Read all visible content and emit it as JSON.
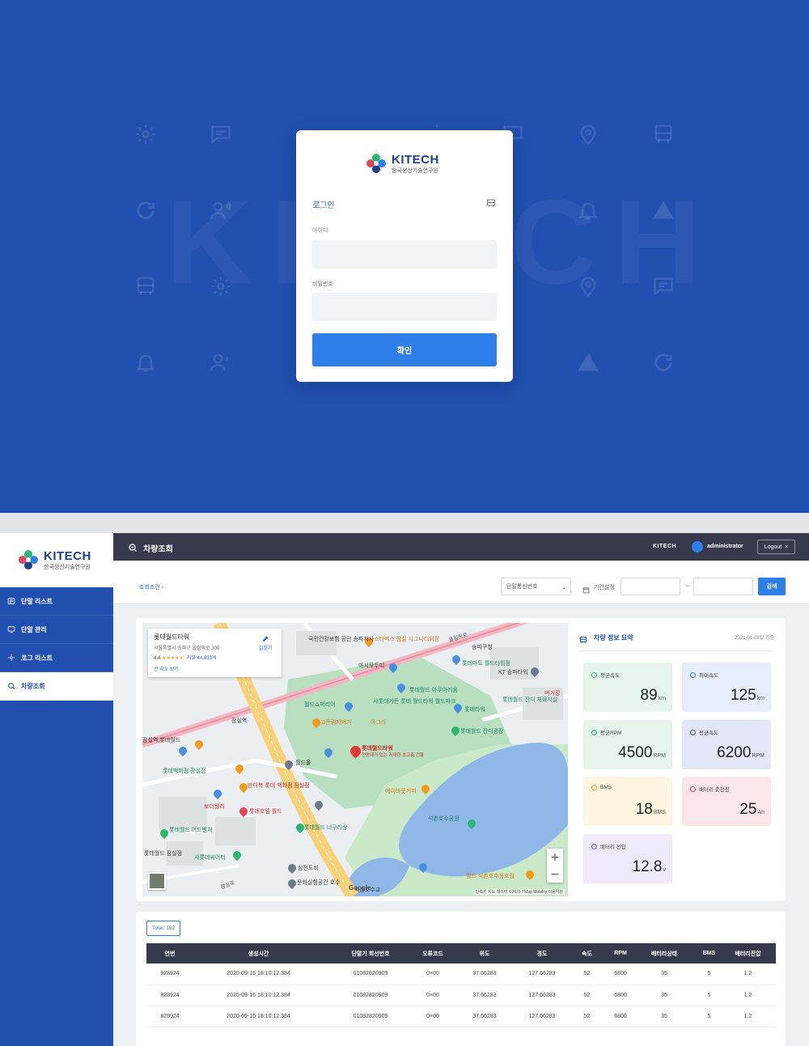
{
  "login": {
    "logo_brand": "KITECH",
    "logo_sub": "한국생산기술연구원",
    "title": "로그인",
    "id_label": "아이디",
    "id_value": "",
    "password_label": "비밀번호",
    "password_value": "",
    "submit_label": "확인",
    "background_word": "KITECH"
  },
  "sidebar": {
    "logo_brand": "KITECH",
    "logo_sub": "한국생산기술연구원",
    "items": [
      {
        "label": "단말 리스트",
        "icon": "list-icon",
        "active": false
      },
      {
        "label": "단말 관리",
        "icon": "device-icon",
        "active": false
      },
      {
        "label": "로그 리스트",
        "icon": "gear-icon",
        "active": false
      },
      {
        "label": "차량조회",
        "icon": "search-icon",
        "active": true
      }
    ]
  },
  "topbar": {
    "page_title": "차량조회",
    "brand": "KITECH",
    "user": "administrator",
    "logout_label": "Logout"
  },
  "filter": {
    "breadcrumb": "조회조건",
    "select_value": "단말통신번호",
    "period_label": "기간설정",
    "date_from": "",
    "date_to": "",
    "separator": "~",
    "search_label": "검색"
  },
  "map": {
    "card": {
      "title": "롯데월드타워",
      "address": "서울특별시 송파구 올림픽로 300",
      "rating": "4.4",
      "stars": "★★★★★",
      "reviews": "리뷰 44,693개",
      "directions": "길찾기",
      "link": "큰 지도 보기"
    },
    "main_place": "롯데월드타워",
    "main_place_sub": "전망대가 있는 거대한 초고층 건물",
    "labels": {
      "l1": "국민건강보험 공단 송파지사",
      "l2": "스타벅스 잠실 시그니티위점",
      "l3": "롯데마트 월드타워점",
      "l4": "KT 송파타워",
      "l5": "마시모두띠",
      "l6": "롯데월드 아쿠아리움",
      "l7": "샤롯데가든 롯데 월드타워 월드파크",
      "l8": "롯데월드 잔디광장",
      "l9": "롯데타워",
      "l10": "잠실역,롯데월드",
      "l11": "롯데백화점 잠실점",
      "l12": "만다복 롯데 백화점 잠실점",
      "l13": "롯데호텔 월드",
      "l14": "롯데월드 어드벤처",
      "l15": "샤롯데씨어터",
      "l16": "롯데월드 너구리상",
      "l17": "석촌호수공원",
      "l18": "삼전도비",
      "l19": "석촌호수교",
      "l20": "월드 석촌호수동호점",
      "l21": "에이바웃커피",
      "l22": "고든램지버거",
      "l23": "아그라",
      "l24": "올림픽로",
      "l25": "잠실로",
      "l26": "잠실역",
      "l27": "송파구청",
      "l28": "월드몰",
      "l29": "보더웰리",
      "l30": "롯데월드 잠실점",
      "l31": "문화실험공간 호수",
      "l32": "월드쇼퍼리어",
      "l33": "버거킹",
      "l34": "롯데월드 잔디 체육시설"
    },
    "attribution": "단축키   지도 데이터 ©2023 TMap Mobility   이용약관",
    "google": "Google",
    "zoom_in": "+",
    "zoom_out": "−"
  },
  "summary": {
    "title": "차량 정보 요약",
    "date": "2021-01-08일 기준",
    "stats": [
      {
        "label": "평균속도",
        "value": "89",
        "unit": "km",
        "color": "green"
      },
      {
        "label": "최대속도",
        "value": "125",
        "unit": "km",
        "color": "blue"
      },
      {
        "label": "평균RPM",
        "value": "4500",
        "unit": "RPM",
        "color": "green"
      },
      {
        "label": "평균속도",
        "value": "6200",
        "unit": "RPM",
        "color": "indigo"
      },
      {
        "label": "BMS",
        "value": "18",
        "unit": "BMS",
        "color": "yellow"
      },
      {
        "label": "배터리 충전량",
        "value": "25",
        "unit": "Ah",
        "color": "pink"
      },
      {
        "label": "배터리 전압",
        "value": "12.8",
        "unit": "v",
        "color": "lavender"
      }
    ]
  },
  "table": {
    "total": "Total: 182",
    "headers": [
      "연번",
      "생성시간",
      "단말기 회선번호",
      "오류코드",
      "위도",
      "경도",
      "속도",
      "RPM",
      "배터리상태",
      "BMS",
      "배터리전압"
    ],
    "rows": [
      [
        "828924",
        "2020-09-16 18:10:12.384",
        "01082820909",
        "0×00",
        "37.66283",
        "127.66283",
        "52",
        "6800",
        "35",
        "5",
        "1.2"
      ],
      [
        "828924",
        "2020-09-16 18:10:12.384",
        "01082820909",
        "0×00",
        "37.66283",
        "127.66283",
        "52",
        "6800",
        "35",
        "5",
        "1.2"
      ],
      [
        "828924",
        "2020-09-16 18:10:12.384",
        "01082820909",
        "0×00",
        "37.66283",
        "127.66283",
        "52",
        "6800",
        "35",
        "5",
        "1.2"
      ]
    ]
  },
  "colors": {
    "primary": "#2150b0",
    "accent": "#2e7fe8",
    "topbar": "#363a4c"
  }
}
